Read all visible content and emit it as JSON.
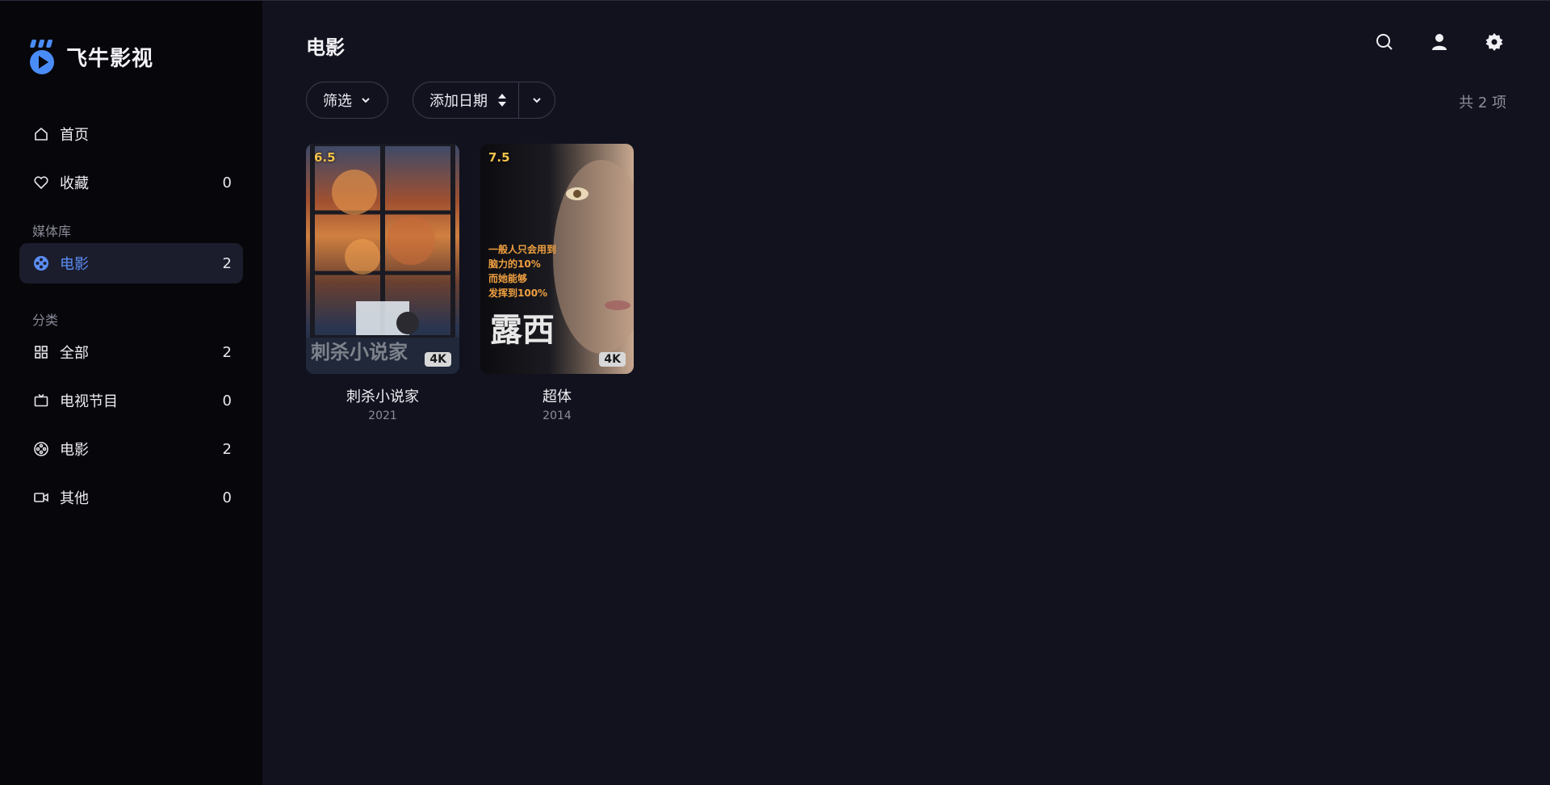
{
  "brand": {
    "name": "飞牛影视",
    "accent": "#4a8cf7"
  },
  "nav": {
    "home": {
      "label": "首页",
      "icon": "home-icon"
    },
    "favorites": {
      "label": "收藏",
      "count": "0",
      "icon": "heart-icon"
    }
  },
  "library": {
    "section_title": "媒体库",
    "items": [
      {
        "label": "电影",
        "count": "2",
        "icon": "film-reel-icon",
        "active": true
      }
    ]
  },
  "categories": {
    "section_title": "分类",
    "items": [
      {
        "label": "全部",
        "count": "2",
        "icon": "grid-icon"
      },
      {
        "label": "电视节目",
        "count": "0",
        "icon": "tv-icon"
      },
      {
        "label": "电影",
        "count": "2",
        "icon": "film-reel-icon"
      },
      {
        "label": "其他",
        "count": "0",
        "icon": "video-camera-icon"
      }
    ]
  },
  "header": {
    "title": "电影",
    "icons": [
      "search-icon",
      "user-icon",
      "settings-icon"
    ]
  },
  "toolbar": {
    "filter_label": "筛选",
    "sort_label": "添加日期"
  },
  "total_label": "共 2 项",
  "movies": [
    {
      "title": "刺杀小说家",
      "year": "2021",
      "rating": "6.5",
      "badge": "4K",
      "poster_text": "刺杀小说家"
    },
    {
      "title": "超体",
      "year": "2014",
      "rating": "7.5",
      "badge": "4K",
      "poster_text": "露西",
      "poster_lines": [
        "一般人只会用到",
        "脑力的10%",
        "而她能够",
        "发挥到100%"
      ]
    }
  ]
}
